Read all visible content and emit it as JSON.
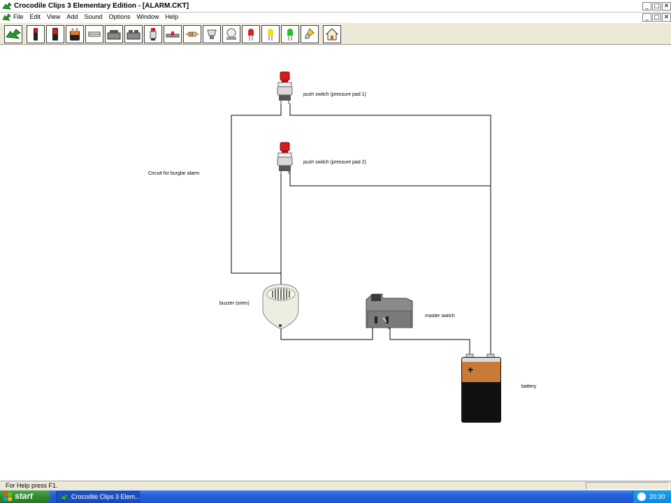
{
  "window": {
    "title": "Crocodile Clips 3 Elementary Edition - [ALARM.CKT]",
    "controls": [
      "_",
      "□",
      "✕"
    ]
  },
  "menu": {
    "items": [
      "File",
      "Edit",
      "View",
      "Add",
      "Sound",
      "Options",
      "Window",
      "Help"
    ]
  },
  "toolbar": {
    "tools": [
      {
        "icon": "crocodile-icon"
      },
      {
        "icon": "cell-battery-icon"
      },
      {
        "icon": "battery-icon"
      },
      {
        "icon": "power-supply-icon"
      },
      {
        "icon": "fuse-icon"
      },
      {
        "icon": "switch-icon"
      },
      {
        "icon": "switch-2way-icon"
      },
      {
        "icon": "push-switch-icon"
      },
      {
        "icon": "slide-resistor-icon"
      },
      {
        "icon": "resistor-icon"
      },
      {
        "icon": "bulb-icon"
      },
      {
        "icon": "motor-icon"
      },
      {
        "icon": "led-red-icon"
      },
      {
        "icon": "led-yellow-icon"
      },
      {
        "icon": "led-green-icon"
      },
      {
        "icon": "buzzer-icon"
      },
      {
        "icon": "home-icon"
      }
    ]
  },
  "circuit": {
    "labels": {
      "circuit_title": "Circuit for burglar alarm",
      "switch1": "push switch (pressure pad 1)",
      "switch2": "push switch (pressure pad 2)",
      "buzzer": "buzzer (siren)",
      "master": "master switch",
      "battery": "battery"
    },
    "battery_sign": "+"
  },
  "status": {
    "text": "For Help press F1."
  },
  "taskbar": {
    "start_label": "start",
    "task_label": "Crocodile Clips 3 Elem...",
    "clock": "20:30"
  },
  "colors": {
    "accent_red": "#d81c1c",
    "battery_copper": "#c87a3a",
    "taskbar_blue": "#245edb",
    "start_green": "#2f8a2f"
  }
}
